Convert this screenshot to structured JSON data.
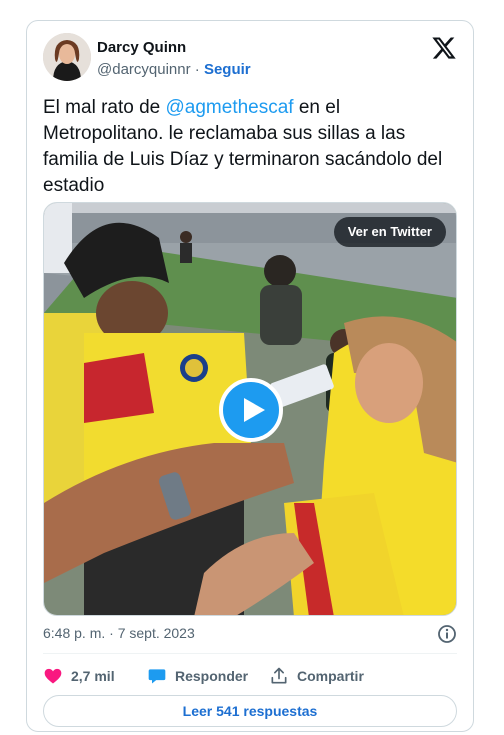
{
  "author": {
    "name": "Darcy Quinn",
    "handle": "@darcyquinnr",
    "separator": " · ",
    "follow_label": "Seguir"
  },
  "icons": {
    "platform": "x-logo-icon",
    "play": "play-icon",
    "info": "info-icon",
    "like": "heart-icon",
    "reply": "chat-bubble-icon",
    "share": "share-upload-icon"
  },
  "tweet": {
    "text_before": "El mal rato de ",
    "mention": "@agmethescaf",
    "text_after": " en el Metropolitano.  le reclamaba sus sillas a las familia de Luis Díaz y terminaron sacándolo del estadio"
  },
  "media": {
    "view_label": "Ver en Twitter"
  },
  "meta": {
    "timestamp": "6:48 p. m. · 7 sept. 2023"
  },
  "actions": {
    "likes": "2,7 mil",
    "reply_label": "Responder",
    "share_label": "Compartir"
  },
  "read_replies_label": "Leer 541 respuestas",
  "colors": {
    "link": "#1d9bf0",
    "follow": "#1d6fd1",
    "like": "#f91880",
    "reply": "#1d9bf0",
    "muted": "#536471"
  }
}
